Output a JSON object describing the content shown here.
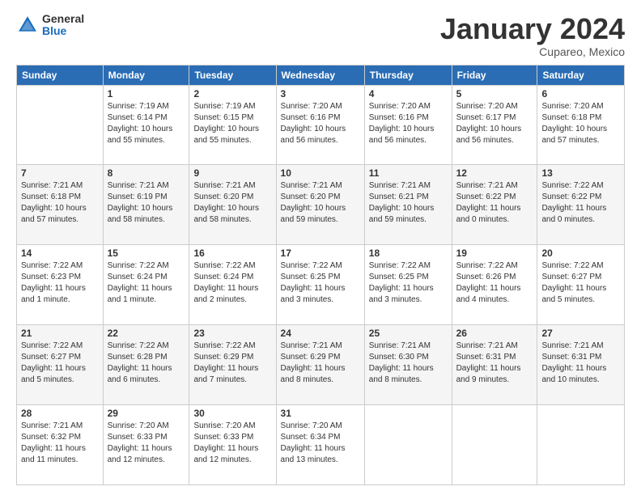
{
  "header": {
    "logo_general": "General",
    "logo_blue": "Blue",
    "month_title": "January 2024",
    "location": "Cupareo, Mexico"
  },
  "days_of_week": [
    "Sunday",
    "Monday",
    "Tuesday",
    "Wednesday",
    "Thursday",
    "Friday",
    "Saturday"
  ],
  "weeks": [
    [
      {
        "day": "",
        "info": ""
      },
      {
        "day": "1",
        "info": "Sunrise: 7:19 AM\nSunset: 6:14 PM\nDaylight: 10 hours\nand 55 minutes."
      },
      {
        "day": "2",
        "info": "Sunrise: 7:19 AM\nSunset: 6:15 PM\nDaylight: 10 hours\nand 55 minutes."
      },
      {
        "day": "3",
        "info": "Sunrise: 7:20 AM\nSunset: 6:16 PM\nDaylight: 10 hours\nand 56 minutes."
      },
      {
        "day": "4",
        "info": "Sunrise: 7:20 AM\nSunset: 6:16 PM\nDaylight: 10 hours\nand 56 minutes."
      },
      {
        "day": "5",
        "info": "Sunrise: 7:20 AM\nSunset: 6:17 PM\nDaylight: 10 hours\nand 56 minutes."
      },
      {
        "day": "6",
        "info": "Sunrise: 7:20 AM\nSunset: 6:18 PM\nDaylight: 10 hours\nand 57 minutes."
      }
    ],
    [
      {
        "day": "7",
        "info": "Sunrise: 7:21 AM\nSunset: 6:18 PM\nDaylight: 10 hours\nand 57 minutes."
      },
      {
        "day": "8",
        "info": "Sunrise: 7:21 AM\nSunset: 6:19 PM\nDaylight: 10 hours\nand 58 minutes."
      },
      {
        "day": "9",
        "info": "Sunrise: 7:21 AM\nSunset: 6:20 PM\nDaylight: 10 hours\nand 58 minutes."
      },
      {
        "day": "10",
        "info": "Sunrise: 7:21 AM\nSunset: 6:20 PM\nDaylight: 10 hours\nand 59 minutes."
      },
      {
        "day": "11",
        "info": "Sunrise: 7:21 AM\nSunset: 6:21 PM\nDaylight: 10 hours\nand 59 minutes."
      },
      {
        "day": "12",
        "info": "Sunrise: 7:21 AM\nSunset: 6:22 PM\nDaylight: 11 hours\nand 0 minutes."
      },
      {
        "day": "13",
        "info": "Sunrise: 7:22 AM\nSunset: 6:22 PM\nDaylight: 11 hours\nand 0 minutes."
      }
    ],
    [
      {
        "day": "14",
        "info": "Sunrise: 7:22 AM\nSunset: 6:23 PM\nDaylight: 11 hours\nand 1 minute."
      },
      {
        "day": "15",
        "info": "Sunrise: 7:22 AM\nSunset: 6:24 PM\nDaylight: 11 hours\nand 1 minute."
      },
      {
        "day": "16",
        "info": "Sunrise: 7:22 AM\nSunset: 6:24 PM\nDaylight: 11 hours\nand 2 minutes."
      },
      {
        "day": "17",
        "info": "Sunrise: 7:22 AM\nSunset: 6:25 PM\nDaylight: 11 hours\nand 3 minutes."
      },
      {
        "day": "18",
        "info": "Sunrise: 7:22 AM\nSunset: 6:25 PM\nDaylight: 11 hours\nand 3 minutes."
      },
      {
        "day": "19",
        "info": "Sunrise: 7:22 AM\nSunset: 6:26 PM\nDaylight: 11 hours\nand 4 minutes."
      },
      {
        "day": "20",
        "info": "Sunrise: 7:22 AM\nSunset: 6:27 PM\nDaylight: 11 hours\nand 5 minutes."
      }
    ],
    [
      {
        "day": "21",
        "info": "Sunrise: 7:22 AM\nSunset: 6:27 PM\nDaylight: 11 hours\nand 5 minutes."
      },
      {
        "day": "22",
        "info": "Sunrise: 7:22 AM\nSunset: 6:28 PM\nDaylight: 11 hours\nand 6 minutes."
      },
      {
        "day": "23",
        "info": "Sunrise: 7:22 AM\nSunset: 6:29 PM\nDaylight: 11 hours\nand 7 minutes."
      },
      {
        "day": "24",
        "info": "Sunrise: 7:21 AM\nSunset: 6:29 PM\nDaylight: 11 hours\nand 8 minutes."
      },
      {
        "day": "25",
        "info": "Sunrise: 7:21 AM\nSunset: 6:30 PM\nDaylight: 11 hours\nand 8 minutes."
      },
      {
        "day": "26",
        "info": "Sunrise: 7:21 AM\nSunset: 6:31 PM\nDaylight: 11 hours\nand 9 minutes."
      },
      {
        "day": "27",
        "info": "Sunrise: 7:21 AM\nSunset: 6:31 PM\nDaylight: 11 hours\nand 10 minutes."
      }
    ],
    [
      {
        "day": "28",
        "info": "Sunrise: 7:21 AM\nSunset: 6:32 PM\nDaylight: 11 hours\nand 11 minutes."
      },
      {
        "day": "29",
        "info": "Sunrise: 7:20 AM\nSunset: 6:33 PM\nDaylight: 11 hours\nand 12 minutes."
      },
      {
        "day": "30",
        "info": "Sunrise: 7:20 AM\nSunset: 6:33 PM\nDaylight: 11 hours\nand 12 minutes."
      },
      {
        "day": "31",
        "info": "Sunrise: 7:20 AM\nSunset: 6:34 PM\nDaylight: 11 hours\nand 13 minutes."
      },
      {
        "day": "",
        "info": ""
      },
      {
        "day": "",
        "info": ""
      },
      {
        "day": "",
        "info": ""
      }
    ]
  ]
}
